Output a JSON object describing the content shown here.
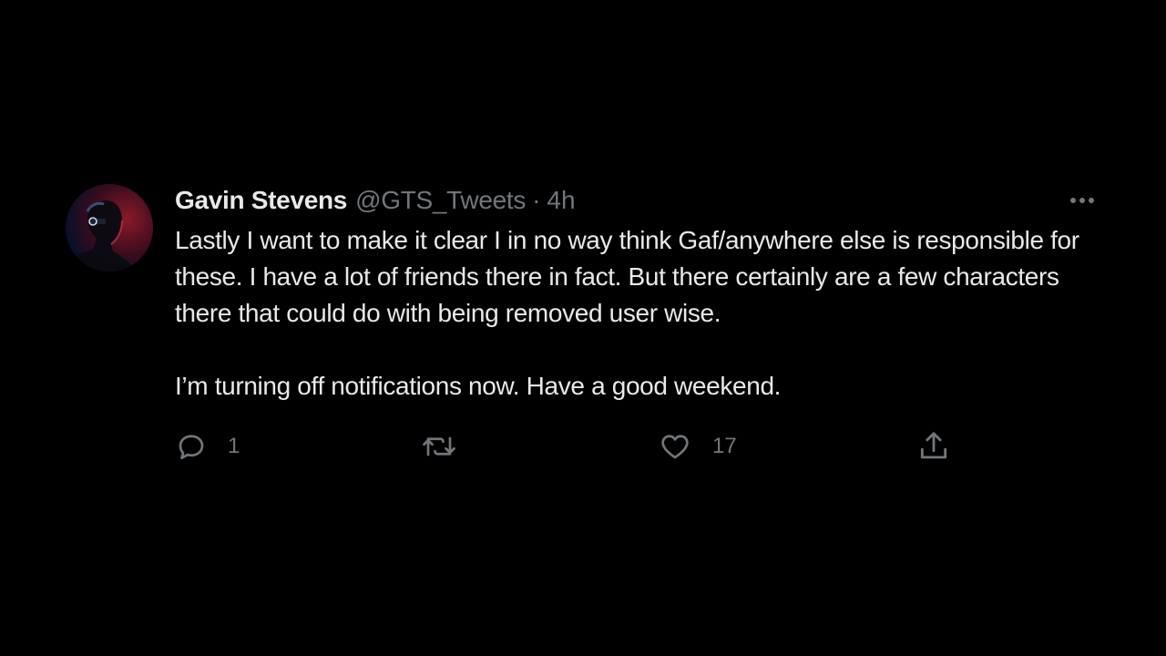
{
  "tweet": {
    "author_name": "Gavin Stevens",
    "author_handle": "@GTS_Tweets",
    "separator": "·",
    "timestamp": "4h",
    "paragraphs": [
      "Lastly I want to make it clear I in no way think Gaf/anywhere else is responsible for these. I have a lot of friends there in fact. But there certainly are a few characters there that could do with being removed user wise.",
      "I’m turning off notifications now. Have a good weekend."
    ],
    "actions": {
      "reply_icon": "reply-icon",
      "reply_count": "1",
      "retweet_icon": "retweet-icon",
      "retweet_count": "",
      "like_icon": "heart-icon",
      "like_count": "17",
      "share_icon": "share-icon"
    }
  },
  "colors": {
    "background": "#000000",
    "primary_text": "#e7e9ea",
    "secondary_text": "#71767b"
  }
}
